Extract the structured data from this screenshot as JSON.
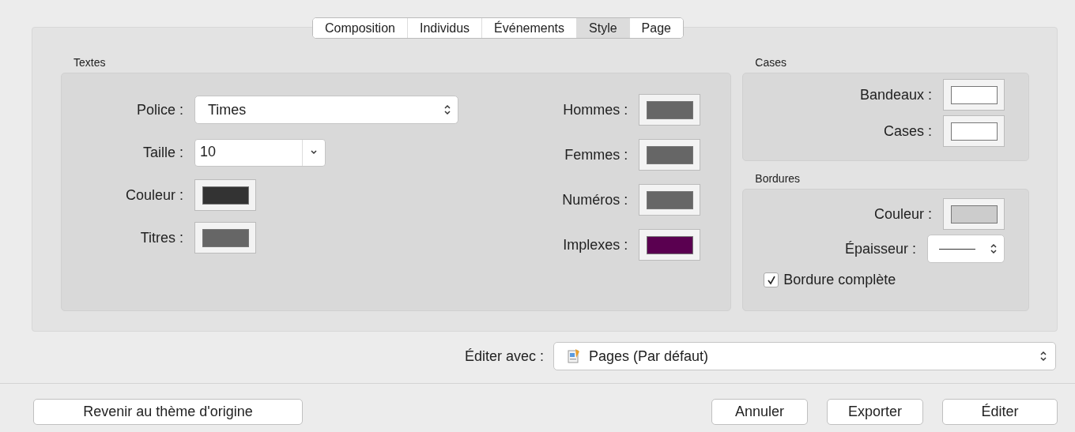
{
  "tabs": [
    {
      "label": "Composition",
      "selected": false
    },
    {
      "label": "Individus",
      "selected": false
    },
    {
      "label": "Événements",
      "selected": false
    },
    {
      "label": "Style",
      "selected": true
    },
    {
      "label": "Page",
      "selected": false
    }
  ],
  "textes": {
    "title": "Textes",
    "police": {
      "label": "Police :",
      "value": "Times"
    },
    "taille": {
      "label": "Taille :",
      "value": "10"
    },
    "left_wells": [
      {
        "label": "Couleur :",
        "color": "#333333"
      },
      {
        "label": "Titres :",
        "color": "#666666"
      }
    ],
    "right_wells": [
      {
        "label": "Hommes :",
        "color": "#666666"
      },
      {
        "label": "Femmes :",
        "color": "#666666"
      },
      {
        "label": "Numéros :",
        "color": "#666666"
      },
      {
        "label": "Implexes :",
        "color": "#5a0050"
      }
    ]
  },
  "cases": {
    "title": "Cases",
    "wells": [
      {
        "label": "Bandeaux :",
        "color": "#ffffff"
      },
      {
        "label": "Cases :",
        "color": "#ffffff"
      }
    ]
  },
  "bordures": {
    "title": "Bordures",
    "couleur": {
      "label": "Couleur :",
      "color": "#cccccc"
    },
    "epaisseur": {
      "label": "Épaisseur :"
    },
    "complete": {
      "label": "Bordure complète",
      "checked": true
    }
  },
  "editer_avec": {
    "label": "Éditer avec :",
    "value": "Pages (Par défaut)"
  },
  "buttons": {
    "reset": "Revenir au thème d'origine",
    "actions": [
      "Annuler",
      "Exporter",
      "Éditer"
    ]
  }
}
